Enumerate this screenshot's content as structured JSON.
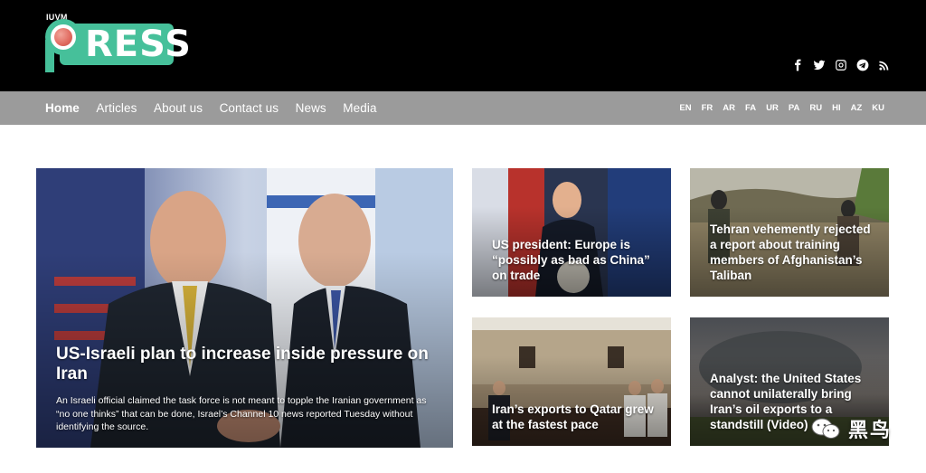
{
  "site": {
    "logo_top": "IUVM",
    "logo_main": "RESS",
    "brand_color": "#46c09a"
  },
  "social": [
    "facebook-icon",
    "twitter-icon",
    "instagram-icon",
    "telegram-icon",
    "rss-icon"
  ],
  "nav": {
    "items": [
      "Home",
      "Articles",
      "About us",
      "Contact us",
      "News",
      "Media"
    ],
    "languages": [
      "EN",
      "FR",
      "AR",
      "FA",
      "UR",
      "PA",
      "RU",
      "HI",
      "AZ",
      "KU"
    ]
  },
  "featured": {
    "title": "US-Israeli plan to increase inside pressure on Iran",
    "excerpt": "An Israeli official claimed the task force is not meant to topple the Iranian government as “no one thinks” that can be done, Israel’s Channel 10 news reported Tuesday without identifying the source."
  },
  "cards": [
    {
      "title": "US president: Europe is “possibly as bad as China” on trade"
    },
    {
      "title": "Tehran vehemently rejected a report about training members of Afghanistan’s Taliban"
    },
    {
      "title": "Iran’s exports to Qatar grew at the fastest pace"
    },
    {
      "title": "Analyst: the United States cannot unilaterally bring Iran’s oil exports to a standstill (Video)"
    }
  ],
  "watermark": {
    "text": "黑鸟"
  }
}
